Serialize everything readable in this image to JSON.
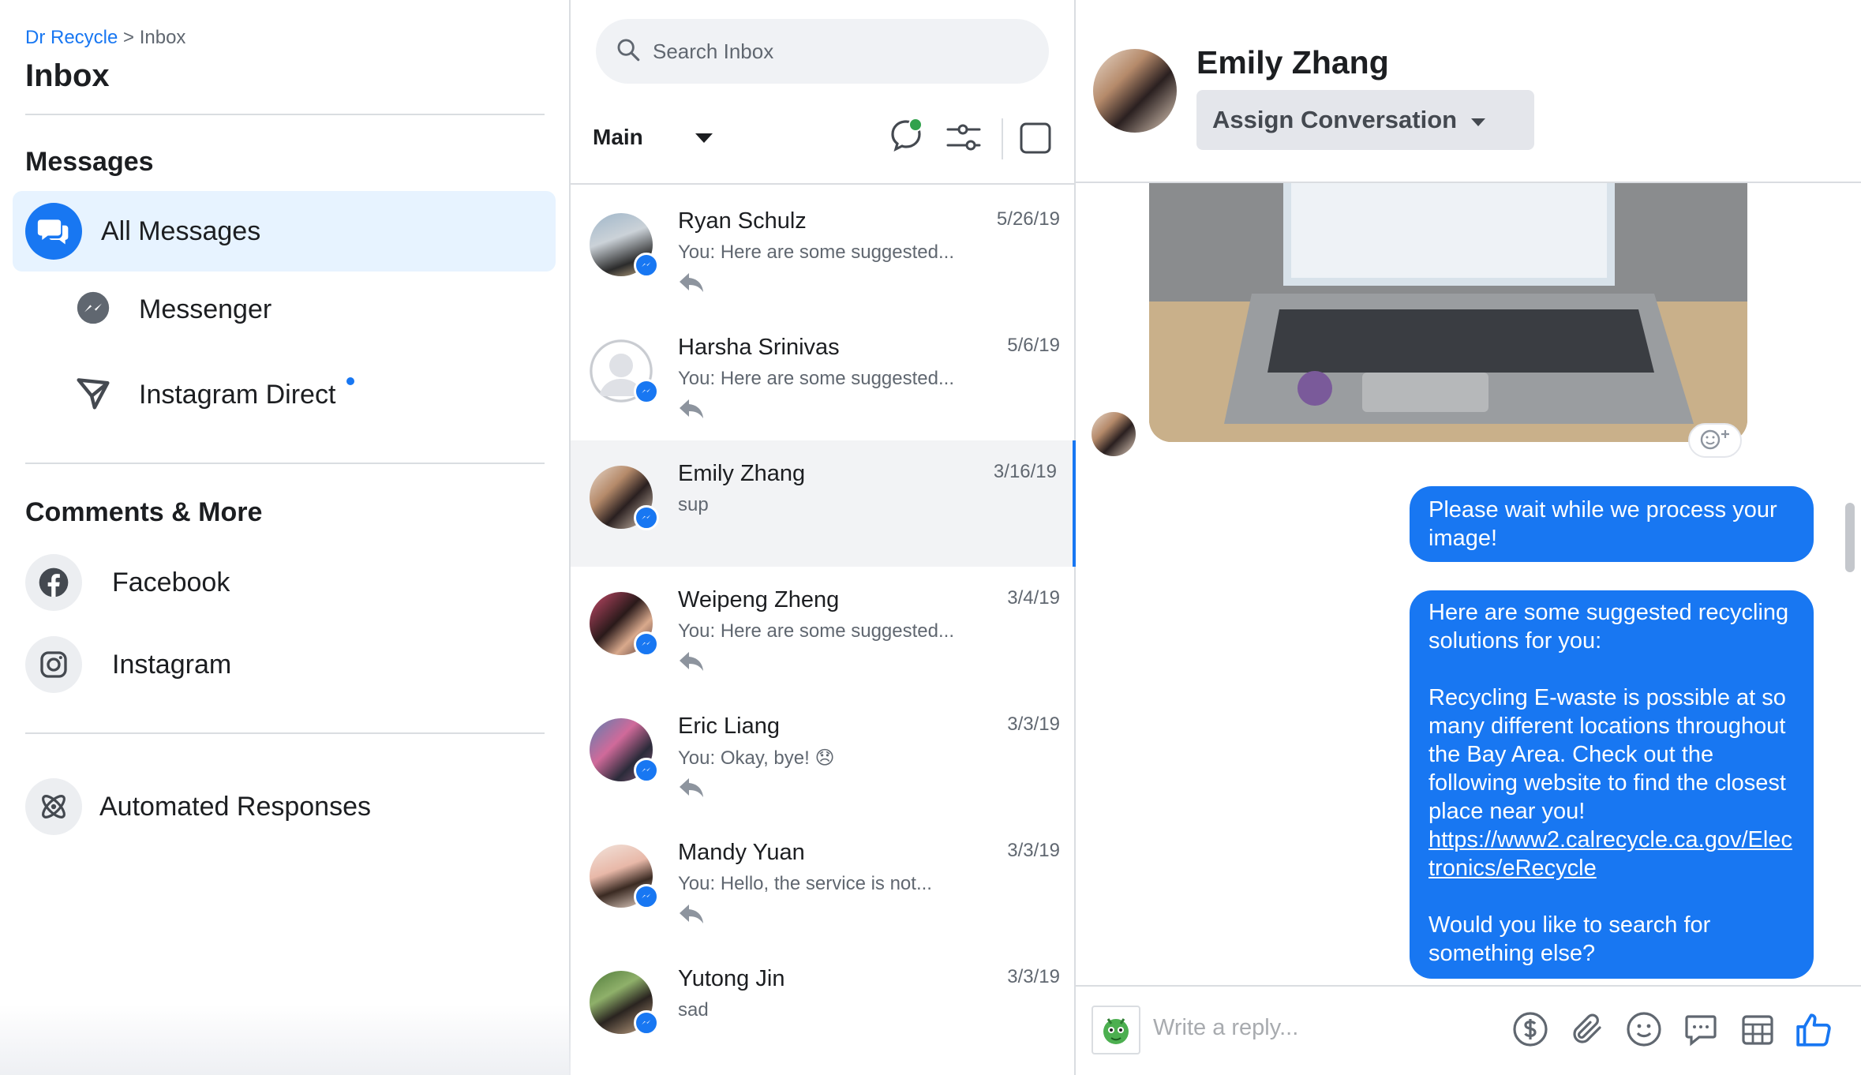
{
  "breadcrumb": {
    "parent": "Dr Recycle",
    "separator": ">",
    "current": "Inbox"
  },
  "page_title": "Inbox",
  "sections": {
    "messages": "Messages",
    "comments": "Comments & More"
  },
  "nav": {
    "all_messages": "All Messages",
    "messenger": "Messenger",
    "instagram_direct": "Instagram Direct",
    "facebook": "Facebook",
    "instagram": "Instagram",
    "automated": "Automated Responses"
  },
  "search": {
    "placeholder": "Search Inbox"
  },
  "list_filter": {
    "label": "Main"
  },
  "conversations": [
    {
      "name": "Ryan Schulz",
      "date": "5/26/19",
      "snippet": "You: Here are some suggested..."
    },
    {
      "name": "Harsha Srinivas",
      "date": "5/6/19",
      "snippet": "You: Here are some suggested..."
    },
    {
      "name": "Emily Zhang",
      "date": "3/16/19",
      "snippet": "sup"
    },
    {
      "name": "Weipeng Zheng",
      "date": "3/4/19",
      "snippet": "You: Here are some suggested..."
    },
    {
      "name": "Eric Liang",
      "date": "3/3/19",
      "snippet": "You: Okay, bye! 😞"
    },
    {
      "name": "Mandy Yuan",
      "date": "3/3/19",
      "snippet": "You: Hello, the service is not..."
    },
    {
      "name": "Yutong Jin",
      "date": "3/3/19",
      "snippet": "sad"
    }
  ],
  "conversation": {
    "contact_name": "Emily Zhang",
    "assign_label": "Assign Conversation",
    "messages": [
      {
        "text": "Please wait while we process your image!"
      },
      {
        "p1": "Here are some suggested recycling solutions for you:",
        "p2": "Recycling E-waste is possible at so many different locations throughout the Bay Area. Check out the following website to find the closest place near you!",
        "link": "https://www2.calrecycle.ca.gov/Electronics/eRecycle",
        "p3": "Would you like to search for something else?"
      }
    ]
  },
  "composer": {
    "placeholder": "Write a reply..."
  },
  "colors": {
    "accent": "#1877f2",
    "selected_bg": "#e7f3ff",
    "online": "#31a24c"
  }
}
